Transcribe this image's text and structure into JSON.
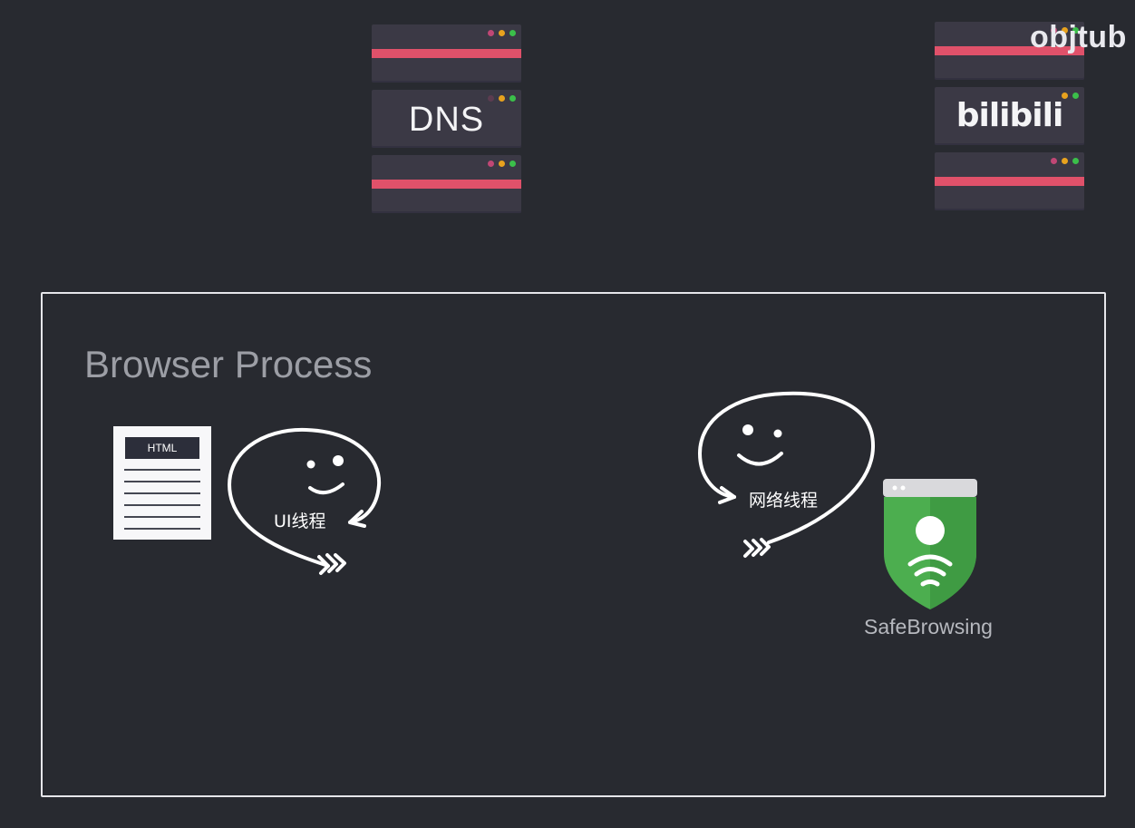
{
  "servers": {
    "dns": {
      "label": "DNS"
    },
    "bilibili": {
      "label": "bilibili"
    }
  },
  "watermark": "objtub",
  "process": {
    "title": "Browser Process"
  },
  "html_doc": {
    "label": "HTML"
  },
  "threads": {
    "ui": {
      "label": "UI线程"
    },
    "network": {
      "label": "网络线程"
    }
  },
  "safebrowsing": {
    "label": "SafeBrowsing"
  },
  "colors": {
    "background": "#282a30",
    "server": "#3b3945",
    "stripe": "#e0516a",
    "shield_green": "#4cae4f",
    "shield_top": "#d9d9dc"
  }
}
